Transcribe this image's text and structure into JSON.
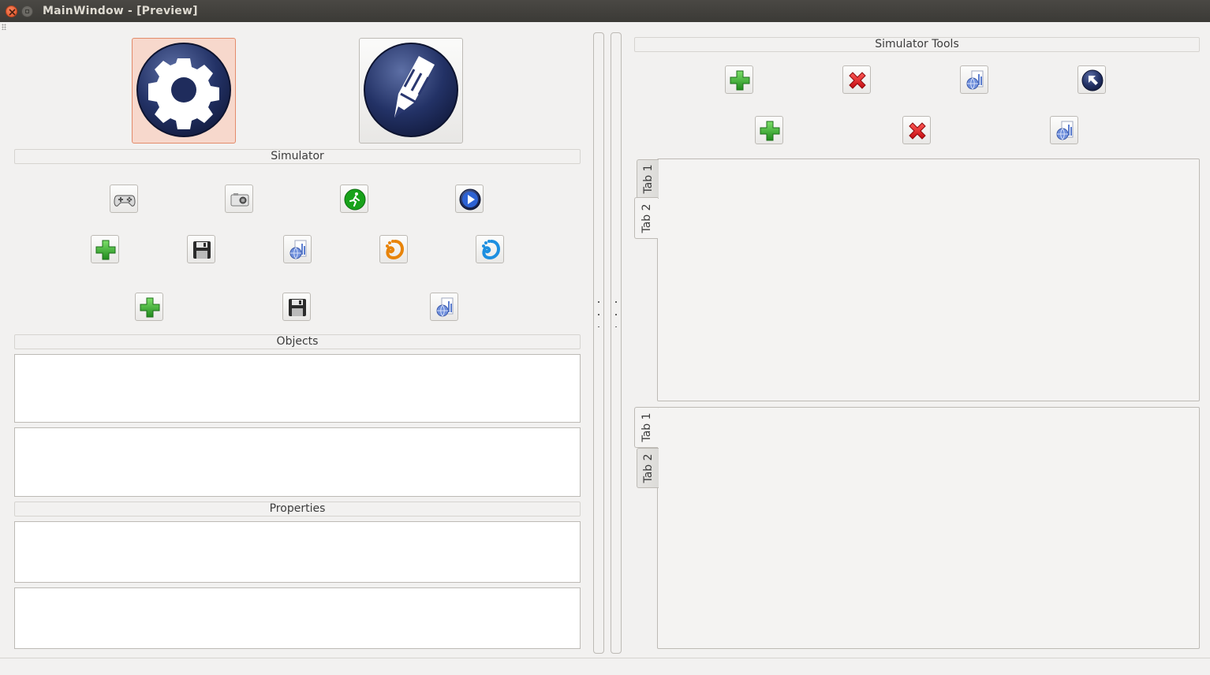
{
  "window": {
    "title": "MainWindow - [Preview]"
  },
  "left": {
    "sections": {
      "simulator": "Simulator",
      "objects": "Objects",
      "properties": "Properties"
    },
    "big_buttons": [
      {
        "icon": "gear-icon",
        "active": true
      },
      {
        "icon": "pencil-icon",
        "active": false
      }
    ],
    "sim_row1": [
      "gamepad-icon",
      "camera-icon",
      "runner-icon",
      "play-icon"
    ],
    "sim_row2": [
      "add-icon",
      "save-icon",
      "globe-document-icon",
      "gimp-icon",
      "gimp-blue-icon"
    ],
    "sim_row3": [
      "add-icon",
      "save-icon",
      "globe-document-icon"
    ]
  },
  "right": {
    "section_title": "Simulator Tools",
    "tools_row1": [
      "add-icon",
      "delete-icon",
      "globe-document-icon",
      "pointer-icon"
    ],
    "tools_row2": [
      "add-icon",
      "delete-icon",
      "globe-document-icon"
    ],
    "tabs_top": {
      "tabs": [
        "Tab 1",
        "Tab 2"
      ],
      "selected": "Tab 2"
    },
    "tabs_bottom": {
      "tabs": [
        "Tab 1",
        "Tab 2"
      ],
      "selected": "Tab 1"
    }
  },
  "colors": {
    "accent_active": "#f7d8cc",
    "icon_navy": "#1f2c5c",
    "plus_green": "#2eaa2a",
    "delete_red": "#e0141a"
  }
}
